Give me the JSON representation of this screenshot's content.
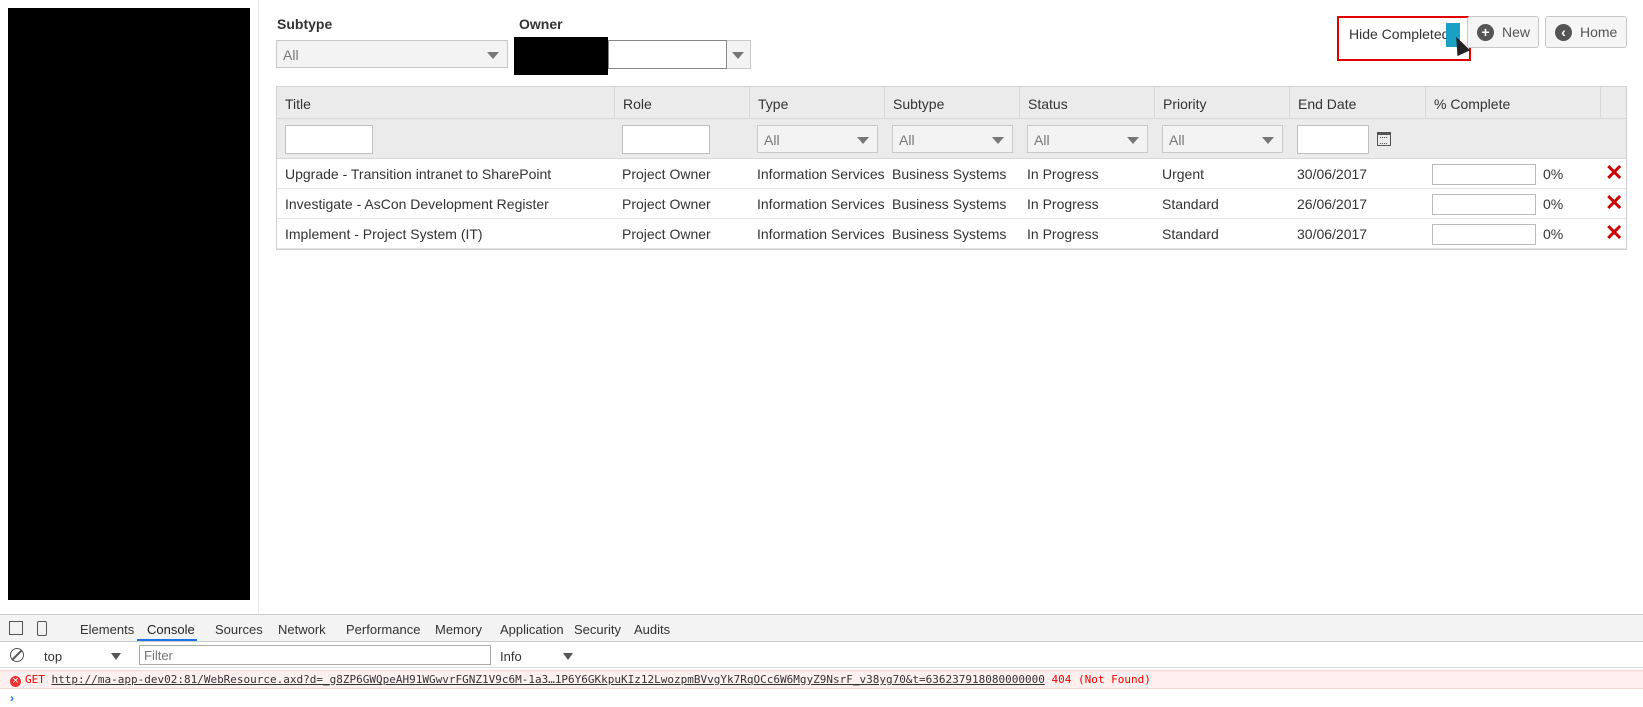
{
  "filters": {
    "subtype_label": "Subtype",
    "subtype_value": "All",
    "owner_label": "Owner"
  },
  "toolbar": {
    "hide_completed_label": "Hide Completed",
    "new_label": "New",
    "home_label": "Home"
  },
  "grid": {
    "columns": [
      "Title",
      "Role",
      "Type",
      "Subtype",
      "Status",
      "Priority",
      "End Date",
      "% Complete"
    ],
    "filter_all": "All",
    "rows": [
      {
        "title": "Upgrade - Transition intranet to SharePoint",
        "role": "Project Owner",
        "type": "Information Services",
        "subtype": "Business Systems",
        "status": "In Progress",
        "priority": "Urgent",
        "end_date": "30/06/2017",
        "percent": 0,
        "percent_label": "0%"
      },
      {
        "title": "Investigate - AsCon Development Register",
        "role": "Project Owner",
        "type": "Information Services",
        "subtype": "Business Systems",
        "status": "In Progress",
        "priority": "Standard",
        "end_date": "26/06/2017",
        "percent": 0,
        "percent_label": "0%"
      },
      {
        "title": "Implement - Project System (IT)",
        "role": "Project Owner",
        "type": "Information Services",
        "subtype": "Business Systems",
        "status": "In Progress",
        "priority": "Standard",
        "end_date": "30/06/2017",
        "percent": 0,
        "percent_label": "0%"
      }
    ]
  },
  "devtools": {
    "tabs": [
      "Elements",
      "Console",
      "Sources",
      "Network",
      "Performance",
      "Memory",
      "Application",
      "Security",
      "Audits"
    ],
    "context": "top",
    "filter_placeholder": "Filter",
    "level": "Info",
    "error": {
      "method": "GET",
      "url": "http://ma-app-dev02:81/WebResource.axd?d=_g8ZP6GWQpeAH91WGwvrFGNZ1V9c6M-1a3…1P6Y6GKkpuKIz12LwozpmBVvgYk7RqOCc6W6MgyZ9NsrF_v38yg70&t=636237918080000000",
      "status": "404 (Not Found)"
    },
    "prompt": "›"
  }
}
